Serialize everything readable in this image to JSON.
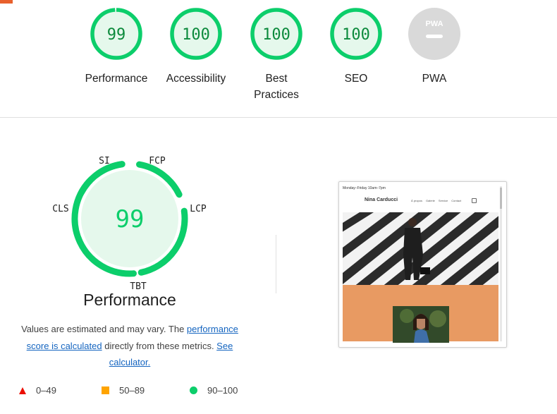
{
  "categories": [
    {
      "label": "Performance",
      "score": "99",
      "fraction": 0.99,
      "status": "pass"
    },
    {
      "label": "Accessibility",
      "score": "100",
      "fraction": 1.0,
      "status": "pass"
    },
    {
      "label": "Best Practices",
      "score": "100",
      "fraction": 1.0,
      "status": "pass"
    },
    {
      "label": "SEO",
      "score": "100",
      "fraction": 1.0,
      "status": "pass"
    },
    {
      "label": "PWA",
      "badge": "PWA",
      "status": "na"
    }
  ],
  "performance": {
    "score": "99",
    "title": "Performance",
    "metrics": [
      "SI",
      "FCP",
      "LCP",
      "TBT",
      "CLS"
    ],
    "note": {
      "prefix": "Values are estimated and may vary. The ",
      "link1": "performance score is calculated",
      "middle": " directly from these metrics. ",
      "link2": "See calculator."
    }
  },
  "legend": [
    {
      "label": "0–49",
      "shape": "triangle",
      "color": "#eb0f00"
    },
    {
      "label": "50–89",
      "shape": "square",
      "color": "#ffa400"
    },
    {
      "label": "90–100",
      "shape": "circle",
      "color": "#0cce6b"
    }
  ],
  "screenshot": {
    "hours": "Monday–Friday 10am–7pm",
    "brand": "Nina Carducci",
    "nav": [
      "À propos",
      "Galerie",
      "Service",
      "Contact"
    ],
    "icon": "instagram-icon"
  },
  "colors": {
    "pass": "#0cce6b",
    "pass_text": "#0c8a3c",
    "pass_fill": "#e5f8ec",
    "na": "#d9d9d9"
  }
}
